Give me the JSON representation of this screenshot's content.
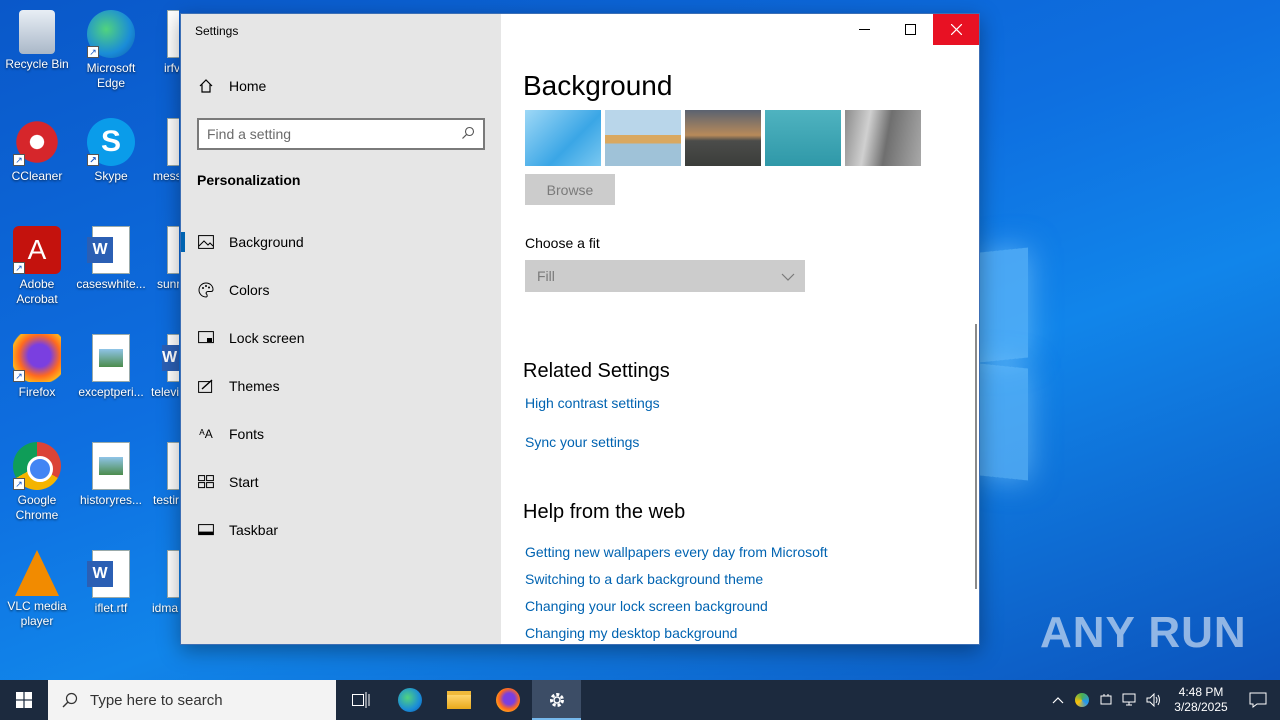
{
  "desktop": {
    "icons": [
      {
        "label": "Recycle Bin"
      },
      {
        "label": "Microsoft Edge"
      },
      {
        "label": "irfv"
      },
      {
        "label": "CCleaner"
      },
      {
        "label": "Skype"
      },
      {
        "label": "mess"
      },
      {
        "label": "Adobe Acrobat"
      },
      {
        "label": "caseswhite..."
      },
      {
        "label": "sunr"
      },
      {
        "label": "Firefox"
      },
      {
        "label": "exceptperi..."
      },
      {
        "label": "televi"
      },
      {
        "label": "Google Chrome"
      },
      {
        "label": "historyres..."
      },
      {
        "label": "testir"
      },
      {
        "label": "VLC media player"
      },
      {
        "label": "iflet.rtf"
      },
      {
        "label": "idma"
      }
    ],
    "watermark": "ANY RUN"
  },
  "window": {
    "title": "Settings",
    "controls": {
      "minimize": "—",
      "maximize": "☐",
      "close": "✕"
    }
  },
  "sidebar": {
    "home_label": "Home",
    "search_placeholder": "Find a setting",
    "section": "Personalization",
    "items": [
      {
        "label": "Background",
        "icon": "image-icon"
      },
      {
        "label": "Colors",
        "icon": "palette-icon"
      },
      {
        "label": "Lock screen",
        "icon": "lock-screen-icon"
      },
      {
        "label": "Themes",
        "icon": "themes-icon"
      },
      {
        "label": "Fonts",
        "icon": "fonts-icon"
      },
      {
        "label": "Start",
        "icon": "start-icon"
      },
      {
        "label": "Taskbar",
        "icon": "taskbar-icon"
      }
    ],
    "active_item": "Background"
  },
  "main": {
    "title": "Background",
    "browse_label": "Browse",
    "fit_label": "Choose a fit",
    "fit_value": "Fill",
    "related_heading": "Related Settings",
    "related_links": [
      "High contrast settings",
      "Sync your settings"
    ],
    "help_heading": "Help from the web",
    "help_links": [
      "Getting new wallpapers every day from Microsoft",
      "Switching to a dark background theme",
      "Changing your lock screen background",
      "Changing my desktop background"
    ]
  },
  "taskbar": {
    "search_placeholder": "Type here to search",
    "time": "4:48 PM",
    "date": "3/28/2025"
  },
  "colors": {
    "accent": "#0063b1",
    "close_red": "#e81123",
    "sidebar_bg": "#e6e6e6",
    "taskbar_bg": "#1c2a3e"
  }
}
